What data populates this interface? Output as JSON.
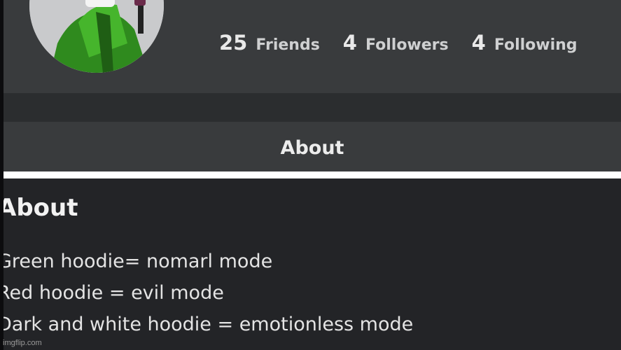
{
  "profile": {
    "stats": [
      {
        "count": "25",
        "label": "Friends"
      },
      {
        "count": "4",
        "label": "Followers"
      },
      {
        "count": "4",
        "label": "Following"
      }
    ]
  },
  "tabs": {
    "about_label": "About"
  },
  "about": {
    "heading": "About",
    "lines": [
      "Green hoodie= nomarl mode",
      "Red hoodie = evil mode",
      "Dark and white hoodie = emotionless mode"
    ]
  },
  "watermark": "imgflip.com",
  "colors": {
    "header_bg": "#393b3d",
    "panel_bg": "#232427",
    "tab_indicator": "#ffffff",
    "avatar_hoodie": "#2f8a1e"
  },
  "icons": {
    "avatar": "green-hoodie-avatar-icon"
  }
}
